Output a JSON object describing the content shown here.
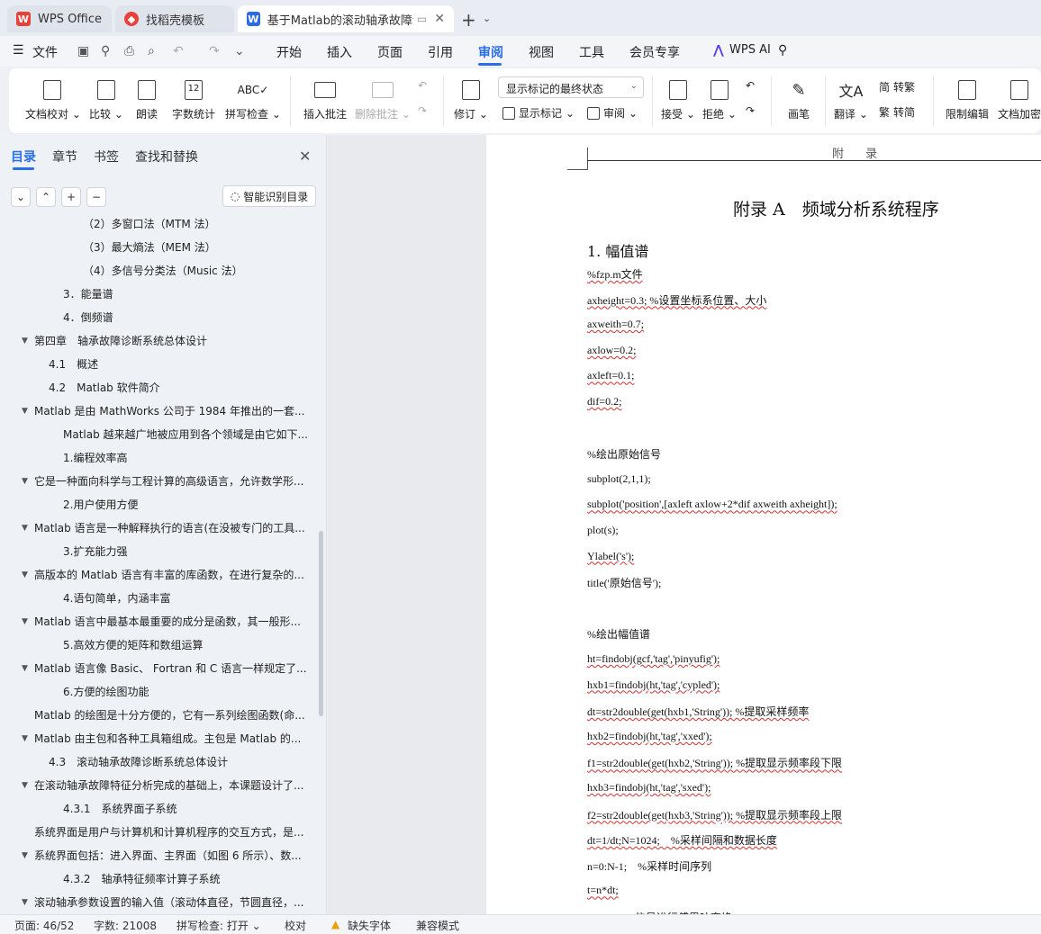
{
  "tabs": {
    "wps": "WPS Office",
    "daoke": "找稻壳模板",
    "doc": "基于Matlab的滚动轴承故障诊"
  },
  "colors": {
    "accent": "#2a6ee8",
    "wps_red": "#e8413a",
    "doc_blue": "#2b6be6",
    "spell_error": "#d03030"
  },
  "menu": {
    "file": "文件",
    "items": [
      "开始",
      "插入",
      "页面",
      "引用",
      "审阅",
      "视图",
      "工具",
      "会员专享"
    ],
    "ai": "WPS AI"
  },
  "ribbon": {
    "proofread": "文档校对",
    "compare": "比较",
    "read_aloud": "朗读",
    "word_count": "字数统计",
    "spell_check": "拼写检查",
    "insert_comment": "插入批注",
    "delete_comment": "删除批注",
    "revise": "修订",
    "markup_select": "显示标记的最终状态",
    "show_markup": "显示标记",
    "review": "审阅",
    "accept": "接受",
    "reject": "拒绝",
    "pen": "画笔",
    "translate": "翻译",
    "to_traditional": "转繁",
    "to_simplified": "转简",
    "restrict_edit": "限制编辑",
    "doc_encrypt": "文档加密"
  },
  "nav": {
    "tabs": [
      "目录",
      "章节",
      "书签",
      "查找和替换"
    ],
    "smart_toc": "智能识别目录",
    "items": [
      "（2）多窗口法（MTM 法）",
      "（3）最大熵法（MEM 法）",
      "（4）多信号分类法（Music 法）",
      "3．能量谱",
      "4．倒频谱",
      "第四章　轴承故障诊断系统总体设计",
      "4.1　概述",
      "4.2　Matlab 软件简介",
      "Matlab 是由 MathWorks 公司于 1984 年推出的一套...",
      "Matlab 越来越广地被应用到各个领域是由它如下...",
      "1.编程效率高",
      "它是一种面向科学与工程计算的高级语言，允许数学形...",
      "2.用户使用方便",
      "Matlab 语言是一种解释执行的语言(在没被专门的工具...",
      "3.扩充能力强",
      "高版本的 Matlab 语言有丰富的库函数，在进行复杂的...",
      "4.语句简单，内涵丰富",
      "Matlab 语言中最基本最重要的成分是函数，其一般形...",
      "5.高效方便的矩阵和数组运算",
      "Matlab 语言像 Basic、 Fortran 和 C 语言一样规定了...",
      "6.方便的绘图功能",
      "Matlab 的绘图是十分方便的，它有一系列绘图函数(命...",
      "Matlab 由主包和各种工具箱组成。主包是 Matlab 的...",
      "4.3　滚动轴承故障诊断系统总体设计",
      "在滚动轴承故障特征分析完成的基础上，本课题设计了...",
      "4.3.1　系统界面子系统",
      "系统界面是用户与计算机和计算机程序的交互方式，是...",
      "系统界面包括：进入界面、主界面（如图 6 所示）、数...",
      "4.3.2　轴承特征频率计算子系统",
      "滚动轴承参数设置的输入值（滚动体直径，节圆直径，..."
    ]
  },
  "doc": {
    "header": "附 录",
    "appendix_title": "附录 A　频域分析系统程序",
    "section": "1.  幅值谱",
    "lines": [
      "%fzp.m文件",
      "axheight=0.3; %设置坐标系位置、大小",
      "axweith=0.7;",
      "axlow=0.2;",
      "axleft=0.1;",
      "dif=0.2;",
      "",
      "%绘出原始信号",
      "subplot(2,1,1);",
      "subplot('position',[axleft axlow+2*dif axweith axheight]);",
      "plot(s);",
      "Ylabel('s');",
      "title('原始信号');",
      "",
      "%绘出幅值谱",
      "ht=findobj(gcf,'tag','pinyufig');",
      "hxb1=findobj(ht,'tag','cypled');",
      "dt=str2double(get(hxb1,'String')); %提取采样频率",
      "hxb2=findobj(ht,'tag','xxed');",
      "f1=str2double(get(hxb2,'String')); %提取显示频率段下限",
      "hxb3=findobj(ht,'tag','sxed');",
      "f2=str2double(get(hxb3,'String')); %提取显示频率段上限",
      "dt=1/dt;N=1024;　%采样间隔和数据长度",
      "n=0:N-1;　%采样时间序列",
      "t=n*dt;",
      "y=fft(s); %信号进行傅里叶变换"
    ]
  },
  "status": {
    "page": "页面: 46/52",
    "words": "字数: 21008",
    "spell": "拼写检查: 打开",
    "proof": "校对",
    "missing_font": "缺失字体",
    "compat": "兼容模式"
  }
}
